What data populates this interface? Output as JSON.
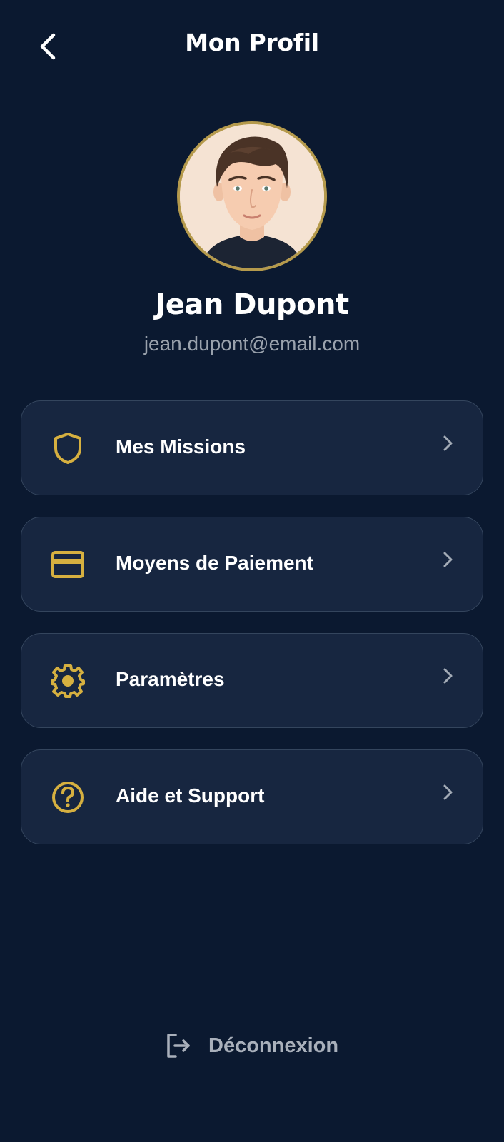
{
  "header": {
    "title": "Mon Profil",
    "back_icon": "chevron-left-icon"
  },
  "profile": {
    "name": "Jean Dupont",
    "email": "jean.dupont@email.com",
    "avatar_border_color": "#b59a4c"
  },
  "menu": {
    "items": [
      {
        "label": "Mes Missions",
        "icon": "shield-icon"
      },
      {
        "label": "Moyens de Paiement",
        "icon": "credit-card-icon"
      },
      {
        "label": "Paramètres",
        "icon": "gear-icon"
      },
      {
        "label": "Aide et Support",
        "icon": "help-circle-icon"
      }
    ],
    "chevron_icon": "chevron-right-icon"
  },
  "logout": {
    "label": "Déconnexion",
    "icon": "logout-icon"
  },
  "colors": {
    "background": "#0b1930",
    "card": "#172640",
    "card_border": "#34455d",
    "accent_gold": "#d6b040",
    "muted_text": "#9aa2ad"
  }
}
